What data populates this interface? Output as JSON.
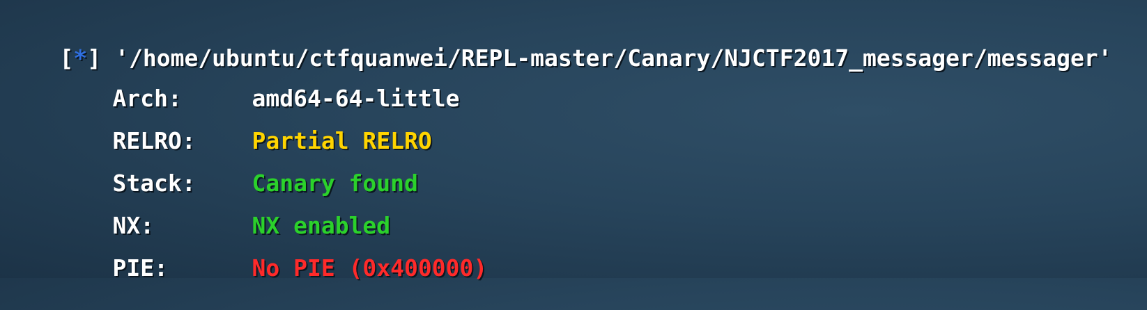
{
  "header": {
    "bracket_open": "[",
    "marker": "*",
    "bracket_close": "]",
    "path": "'/home/ubuntu/ctfquanwei/REPL-master/Canary/NJCTF2017_messager/messager'"
  },
  "checksec": [
    {
      "label": "Arch:",
      "value": "amd64-64-little",
      "color": "#ffffff"
    },
    {
      "label": "RELRO:",
      "value": "Partial RELRO",
      "color": "#ffd400"
    },
    {
      "label": "Stack:",
      "value": "Canary found",
      "color": "#2bd12b"
    },
    {
      "label": "NX:",
      "value": "NX enabled",
      "color": "#2bd12b"
    },
    {
      "label": "PIE:",
      "value": "No PIE (0x400000)",
      "color": "#ff2a2a"
    }
  ]
}
